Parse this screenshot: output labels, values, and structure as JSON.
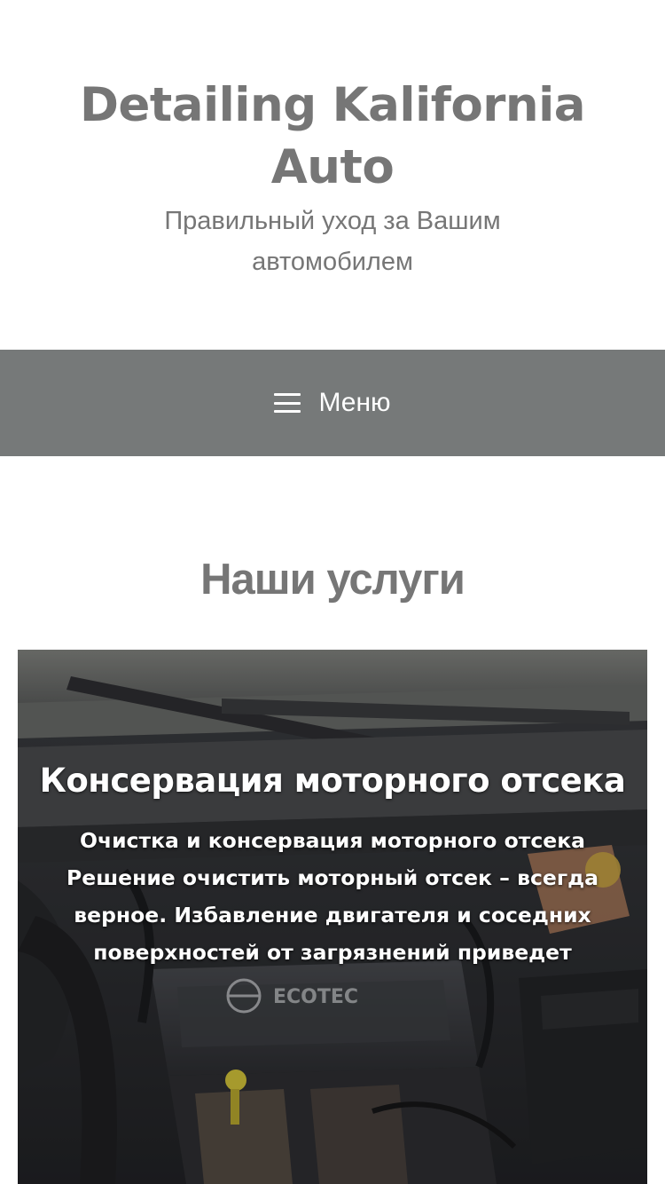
{
  "header": {
    "site_title": "Detailing Kalifornia Auto",
    "tagline": "Правильный уход за Вашим автомобилем"
  },
  "menu": {
    "label": "Меню",
    "icon": "hamburger-icon",
    "background_color": "#767979"
  },
  "services": {
    "heading": "Наши услуги",
    "items": [
      {
        "title": "Консервация моторного отсека",
        "excerpt": "Очистка и консервация моторного отсека Решение очистить моторный отсек – всегда верное. Избавление двигателя и соседних поверхностей от загрязнений приведет",
        "image": "engine-bay-photo",
        "image_badge": "ECOTEC"
      }
    ]
  },
  "colors": {
    "text_gray": "#767676",
    "menu_bar": "#767979",
    "white": "#ffffff"
  }
}
